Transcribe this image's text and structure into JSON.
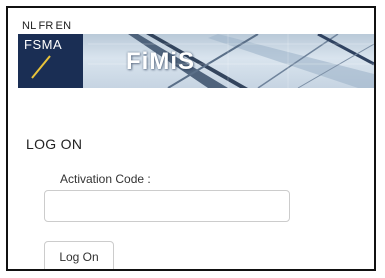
{
  "language_switcher": {
    "items": [
      "NL",
      "FR",
      "EN"
    ]
  },
  "header": {
    "logo_text": "FSMA",
    "app_name": "FiMiS",
    "logo_color": "#1a2e54"
  },
  "login": {
    "title": "LOG ON",
    "activation_label": "Activation Code :",
    "activation_value": "",
    "activation_placeholder": "",
    "submit_label": "Log On"
  }
}
